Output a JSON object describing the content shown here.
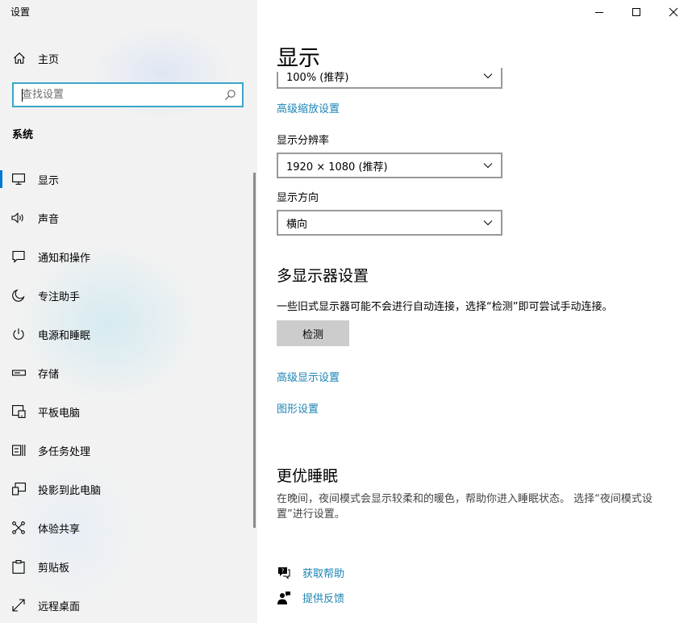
{
  "app": {
    "title": "设置"
  },
  "sidebar": {
    "home_label": "主页",
    "search_placeholder": "查找设置",
    "section_label": "系统",
    "items": [
      {
        "label": "显示",
        "icon": "monitor-icon",
        "active": true
      },
      {
        "label": "声音",
        "icon": "speaker-icon",
        "active": false
      },
      {
        "label": "通知和操作",
        "icon": "notification-icon",
        "active": false
      },
      {
        "label": "专注助手",
        "icon": "moon-icon",
        "active": false
      },
      {
        "label": "电源和睡眠",
        "icon": "power-icon",
        "active": false
      },
      {
        "label": "存储",
        "icon": "storage-icon",
        "active": false
      },
      {
        "label": "平板电脑",
        "icon": "tablet-icon",
        "active": false
      },
      {
        "label": "多任务处理",
        "icon": "multitask-icon",
        "active": false
      },
      {
        "label": "投影到此电脑",
        "icon": "project-icon",
        "active": false
      },
      {
        "label": "体验共享",
        "icon": "share-icon",
        "active": false
      },
      {
        "label": "剪贴板",
        "icon": "clipboard-icon",
        "active": false
      },
      {
        "label": "远程桌面",
        "icon": "remote-desktop-icon",
        "active": false
      }
    ]
  },
  "main": {
    "page_title": "显示",
    "scale_value": "100% (推荐)",
    "advanced_scaling_link": "高级缩放设置",
    "resolution_label": "显示分辨率",
    "resolution_value": "1920 × 1080 (推荐)",
    "orientation_label": "显示方向",
    "orientation_value": "横向",
    "multi_display_heading": "多显示器设置",
    "multi_display_desc": "一些旧式显示器可能不会进行自动连接，选择“检测”即可尝试手动连接。",
    "detect_button": "检测",
    "advanced_display_link": "高级显示设置",
    "graphics_link": "图形设置",
    "sleep_heading": "更优睡眠",
    "sleep_desc": "在晚间，夜间模式会显示较柔和的暖色，帮助你进入睡眠状态。 选择“夜间模式设置”进行设置。",
    "get_help": "获取帮助",
    "give_feedback": "提供反馈"
  },
  "colors": {
    "accent": "#0078d4",
    "link": "#1d84b5",
    "search_border": "#3aa6c9",
    "sidebar_bg": "#f2f2f2"
  }
}
